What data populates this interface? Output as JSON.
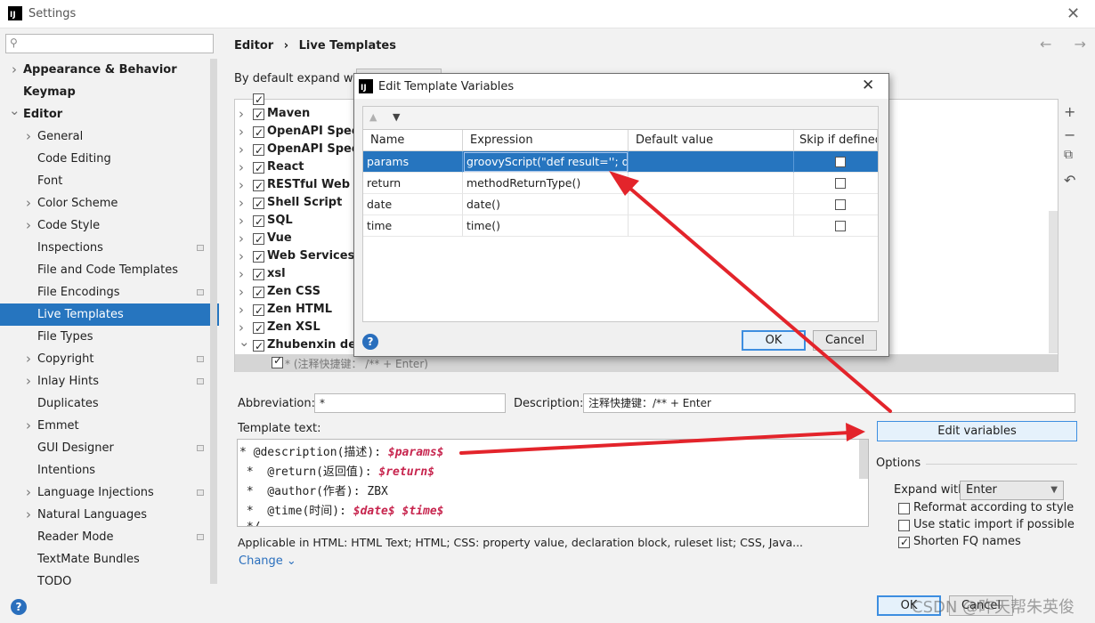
{
  "window": {
    "title": "Settings",
    "logo_icon": "intellij-logo-icon"
  },
  "search": {
    "placeholder": "",
    "value": ""
  },
  "sidebar": {
    "items": [
      {
        "label": "Appearance & Behavior",
        "bold": true,
        "chevron": "right"
      },
      {
        "label": "Keymap",
        "bold": true
      },
      {
        "label": "Editor",
        "bold": true,
        "chevron": "down"
      },
      {
        "label": "General",
        "chevron": "right"
      },
      {
        "label": "Code Editing"
      },
      {
        "label": "Font"
      },
      {
        "label": "Color Scheme",
        "chevron": "right"
      },
      {
        "label": "Code Style",
        "chevron": "right"
      },
      {
        "label": "Inspections",
        "config": true
      },
      {
        "label": "File and Code Templates"
      },
      {
        "label": "File Encodings",
        "config": true
      },
      {
        "label": "Live Templates",
        "selected": true
      },
      {
        "label": "File Types"
      },
      {
        "label": "Copyright",
        "chevron": "right",
        "config": true
      },
      {
        "label": "Inlay Hints",
        "chevron": "right",
        "config": true
      },
      {
        "label": "Duplicates"
      },
      {
        "label": "Emmet",
        "chevron": "right"
      },
      {
        "label": "GUI Designer",
        "config": true
      },
      {
        "label": "Intentions"
      },
      {
        "label": "Language Injections",
        "chevron": "right",
        "config": true
      },
      {
        "label": "Natural Languages",
        "chevron": "right"
      },
      {
        "label": "Reader Mode",
        "config": true
      },
      {
        "label": "TextMate Bundles"
      },
      {
        "label": "TODO"
      }
    ]
  },
  "breadcrumb": {
    "parent": "Editor",
    "separator": "›",
    "current": "Live Templates"
  },
  "nav_arrows": "← →",
  "expand_line": "By default expand with",
  "tree": {
    "rows": [
      {
        "label": "Maven"
      },
      {
        "label": "OpenAPI Specif"
      },
      {
        "label": "OpenAPI Specif"
      },
      {
        "label": "React"
      },
      {
        "label": "RESTful Web Se"
      },
      {
        "label": "Shell Script"
      },
      {
        "label": "SQL"
      },
      {
        "label": "Vue"
      },
      {
        "label": "Web Services"
      },
      {
        "label": "xsl"
      },
      {
        "label": "Zen CSS"
      },
      {
        "label": "Zen HTML"
      },
      {
        "label": "Zen XSL"
      },
      {
        "label": "Zhubenxin de z",
        "chevron": "down"
      }
    ],
    "selected_child": "* (注释快捷键： /** + Enter)"
  },
  "tools": {
    "add": "+",
    "remove": "−",
    "copy": "⧉",
    "revert": "↶"
  },
  "form": {
    "abbreviation_label": "Abbreviation:",
    "abbreviation_value": "*",
    "description_label": "Description:",
    "description_value": "注释快捷键：/** + Enter",
    "template_text_label": "Template text:",
    "template_lines": [
      {
        "prefix": "* @description(描述): ",
        "var": "$params$"
      },
      {
        "prefix": " *  @return(返回值): ",
        "var": "$return$"
      },
      {
        "prefix": " *  @author(作者): ZBX",
        "var": ""
      },
      {
        "prefix": " *  @time(时间): ",
        "var": "$date$ $time$"
      },
      {
        "prefix": " */",
        "var": ""
      }
    ],
    "applicable": "Applicable in HTML: HTML Text; HTML; CSS: property value, declaration block, ruleset list; CSS, Java...",
    "change_link": "Change ⌄"
  },
  "options": {
    "edit_variables": "Edit variables",
    "title": "Options",
    "expand_with_label": "Expand with",
    "expand_with_value": "Enter",
    "checkboxes": [
      {
        "label": "Reformat according to style",
        "checked": false
      },
      {
        "label": "Use static import if possible",
        "checked": false
      },
      {
        "label": "Shorten FQ names",
        "checked": true
      }
    ]
  },
  "footer": {
    "ok": "OK",
    "cancel": "Cancel",
    "help": "?"
  },
  "watermark": "CSDN @昨天帮朱英俊",
  "dialog": {
    "title": "Edit Template Variables",
    "toolbar": {
      "up": "▲",
      "down": "▼"
    },
    "columns": [
      "Name",
      "Expression",
      "Default value",
      "Skip if defined"
    ],
    "rows": [
      {
        "name": "params",
        "expression": "groovyScript(\"def result=''; d...",
        "default": "",
        "skip": false,
        "selected": true
      },
      {
        "name": "return",
        "expression": "methodReturnType()",
        "default": "",
        "skip": false
      },
      {
        "name": "date",
        "expression": "date()",
        "default": "",
        "skip": false
      },
      {
        "name": "time",
        "expression": "time()",
        "default": "",
        "skip": false
      }
    ],
    "ok": "OK",
    "cancel": "Cancel",
    "help": "?"
  },
  "colors": {
    "accent": "#2675bf",
    "arrow": "#e3242b",
    "variable": "#c7254e",
    "link": "#2a6fbd"
  }
}
